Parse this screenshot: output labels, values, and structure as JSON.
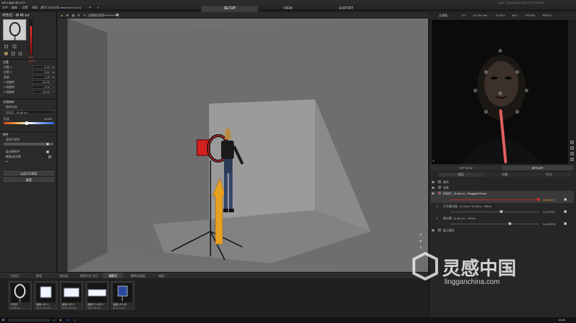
{
  "app": {
    "title": "set.a.light 3D v2.0",
    "title_right": "Light - Recording 2018 07/02 1645/4"
  },
  "menu": {
    "items": [
      "文件",
      "编辑",
      "设置",
      "帮助",
      "[教学 光光光网 www.xxxxx.com]"
    ]
  },
  "modes": {
    "tabs": [
      "SETUP",
      "VIEW",
      "EXPORT"
    ],
    "active": "SETUP"
  },
  "viewport_toolbar": {
    "label": "主摄像机视角"
  },
  "left_panel": {
    "selected_name": "环形灯 - Ø 48 cm",
    "power_value": "100",
    "power_unit": "ψ071",
    "section_position": "位置",
    "fields": [
      {
        "label": "位置 X",
        "value": "4.13",
        "unit": "m"
      },
      {
        "label": "位置 Y",
        "value": "3.81",
        "unit": "m"
      },
      {
        "label": "高度",
        "value": "1.26",
        "unit": "m"
      },
      {
        "label": "Y 轴旋转",
        "value": "-25.22",
        "unit": "°"
      },
      {
        "label": "X 轴旋转",
        "value": "3.00",
        "unit": "°"
      },
      {
        "label": "Z 轴旋转",
        "value": "-18.43",
        "unit": "°"
      }
    ],
    "section_modifier": "光线修饰",
    "modifier_label": "修饰光效",
    "modifier_select": "环形灯 - Ø 48 cm",
    "color_label": "色温",
    "color_value": "5400K",
    "section_gel": "附件",
    "gel_label": "滤色片附件",
    "gel2_label": "柔光罩附件",
    "gel3_label": "蜂巢/遮光罩",
    "add_label": "+",
    "btn_apply": "从此灯光预设",
    "btn_reset": "重置"
  },
  "camera_strip": {
    "items": [
      "全画幅",
      "3:2",
      "24-105 mm",
      "1/125 s",
      "f/8.0",
      "ISO100",
      "5500 K"
    ]
  },
  "right_tabs": {
    "tabs": [
      "TOP VIEW",
      "SETLIST"
    ],
    "active": "SETLIST",
    "sub_tabs": [
      "图层",
      "设备",
      "灯光"
    ]
  },
  "layers": [
    {
      "name": "模特",
      "value": ""
    },
    {
      "name": "背景",
      "value": ""
    },
    {
      "name": "环形灯 - Ø 48 cm - Ringlight Fixed",
      "value": "100 ψ071"
    },
    {
      "name": "大号柔光箱 - Ø 22cm / 5 23cm - 9MHz",
      "value": "1s (7/9%)"
    },
    {
      "name": "雷达罩 - Ø 56 cm - 100Hz",
      "value": "1s (100%)"
    },
    {
      "name": "展示模型",
      "value": ""
    }
  ],
  "bottom_tabs": {
    "tabs": [
      "闪光灯",
      "影室",
      "遮光板",
      "常亮灯光 主灯",
      "摄影灯",
      "模特及道具",
      "相机"
    ],
    "active": "摄影灯"
  },
  "shelf": [
    {
      "name": "环形灯",
      "size": "Ø 48 cm"
    },
    {
      "name": "面板 LED 1",
      "size": "30.5 x 30 cm"
    },
    {
      "name": "面板 LED 2",
      "size": "60.5 x 30 cm"
    },
    {
      "name": "面板 LT-LED 3",
      "size": "120 x 30 cm"
    },
    {
      "name": "面板 LED 彩",
      "size": "Ø 11.2 cm"
    }
  ],
  "watermark": {
    "brand": "灵感中国",
    "url": "lingganchina.com"
  },
  "taskbar": {
    "time": "15:49"
  },
  "colors": {
    "accent_red": "#e03030",
    "accent_orange": "#e8a020",
    "viewport_bg": "#6f6f6f"
  }
}
